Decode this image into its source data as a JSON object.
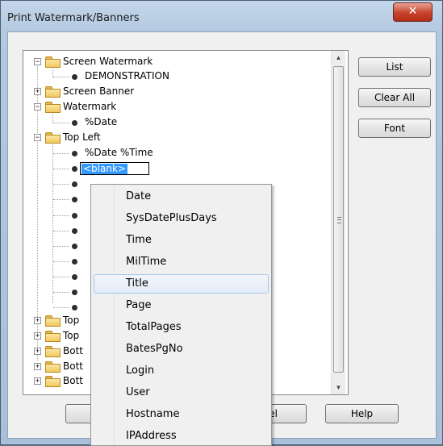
{
  "window": {
    "title": "Print Watermark/Banners",
    "close_glyph": "✕"
  },
  "tree": {
    "nodes": [
      {
        "label": "Screen Watermark",
        "kind": "folder",
        "state": "expanded"
      },
      {
        "label": "DEMONSTRATION",
        "kind": "leaf"
      },
      {
        "label": "Screen Banner",
        "kind": "folder",
        "state": "collapsed"
      },
      {
        "label": "Watermark",
        "kind": "folder",
        "state": "expanded"
      },
      {
        "label": "%Date",
        "kind": "leaf"
      },
      {
        "label": "Top Left",
        "kind": "folder",
        "state": "expanded"
      },
      {
        "label": "%Date %Time",
        "kind": "leaf"
      },
      {
        "label": "<blank>",
        "kind": "leaf-editing"
      },
      {
        "label": "Top",
        "kind": "folder",
        "state": "collapsed"
      },
      {
        "label": "Top",
        "kind": "folder",
        "state": "collapsed"
      },
      {
        "label": "Bott",
        "kind": "folder",
        "state": "collapsed"
      },
      {
        "label": "Bott",
        "kind": "folder",
        "state": "collapsed"
      },
      {
        "label": "Bott",
        "kind": "folder",
        "state": "collapsed"
      }
    ]
  },
  "buttons": {
    "list": "List",
    "clear_all": "Clear All",
    "font": "Font",
    "cancel": "ncel",
    "help": "Help"
  },
  "menu": {
    "items": [
      "Date",
      "SysDatePlusDays",
      "Time",
      "MilTime",
      "Title",
      "Page",
      "TotalPages",
      "BatesPgNo",
      "Login",
      "User",
      "Hostname",
      "IPAddress"
    ],
    "highlighted": "Title"
  },
  "icons": {
    "expanded": "minus-icon",
    "collapsed": "plus-icon",
    "folder": "folder-icon",
    "leaf": "bullet-icon"
  },
  "colors": {
    "selection": "#3399ff",
    "close_button": "#c8412b",
    "menu_highlight": "#e3ecf8"
  }
}
